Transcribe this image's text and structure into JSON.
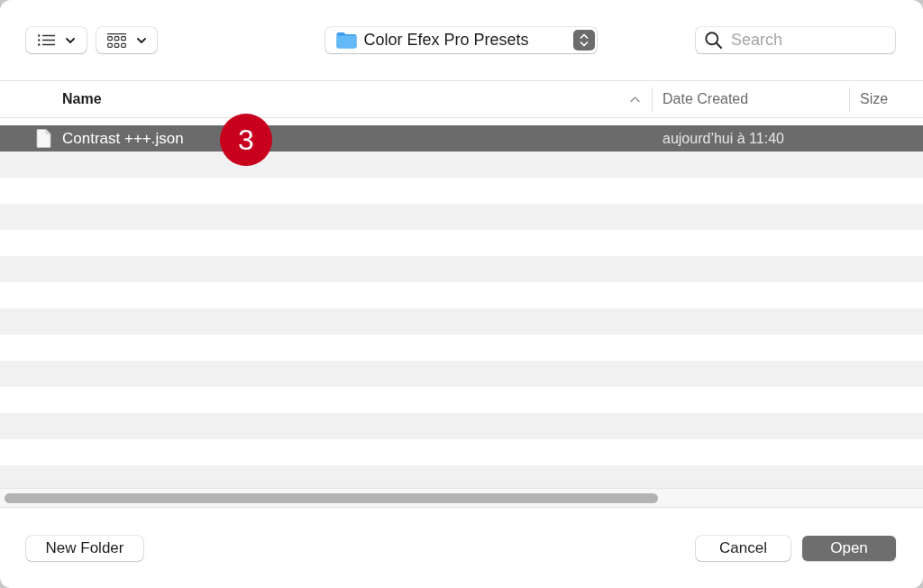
{
  "toolbar": {
    "view_buttons": [
      {
        "kind": "list"
      },
      {
        "kind": "grid"
      }
    ],
    "location": {
      "label": "Color Efex Pro Presets"
    },
    "search": {
      "placeholder": "Search"
    }
  },
  "columns": [
    {
      "label": "Name",
      "sorted": true
    },
    {
      "label": "Date Created",
      "sorted": false
    },
    {
      "label": "Size",
      "sorted": false
    }
  ],
  "files": [
    {
      "name": "Contrast +++.json",
      "date_created": "aujourd’hui à 11:40",
      "selected": true
    }
  ],
  "callout": {
    "label": "3"
  },
  "buttons": [
    {
      "label": "New Folder",
      "kind": "secondary"
    },
    {
      "label": "Cancel",
      "kind": "secondary"
    },
    {
      "label": "Open",
      "kind": "default"
    }
  ]
}
